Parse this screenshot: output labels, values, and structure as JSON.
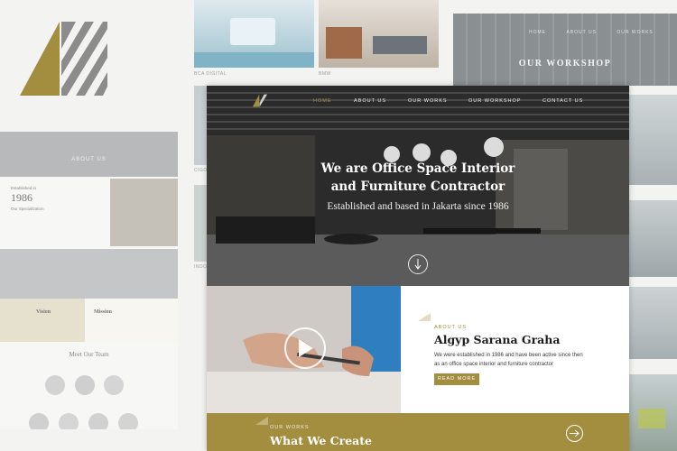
{
  "brand": {
    "gold": "#a38e40",
    "dark": "#2a2a2a"
  },
  "logo": {
    "icon": "brand-logo-triangle-stripes"
  },
  "background": {
    "thumbs": [
      {
        "caption": "BCA DIGITAL"
      },
      {
        "caption": "BMW"
      },
      {
        "caption": "CIGO"
      },
      {
        "caption": "INDO"
      }
    ],
    "workshop_page": {
      "nav": [
        "HOME",
        "ABOUT US",
        "OUR WORKS"
      ],
      "title": "OUR WORKSHOP"
    },
    "about_page": {
      "hero_title": "ABOUT US",
      "established_label": "Established in",
      "established_year": "1986",
      "specialization_label": "Our Specialization",
      "vision": "Vision",
      "mission": "Mission",
      "team_title": "Meet Our Team"
    }
  },
  "hero": {
    "nav": [
      {
        "label": "HOME",
        "active": true
      },
      {
        "label": "ABOUT US"
      },
      {
        "label": "OUR WORKS"
      },
      {
        "label": "OUR WORKSHOP"
      },
      {
        "label": "CONTACT US"
      }
    ],
    "title_line1": "We are Office Space Interior",
    "title_line2": "and Furniture Contractor",
    "subtitle": "Established and based in Jakarta since 1986",
    "scroll_icon": "arrow-down-circle-icon"
  },
  "about": {
    "eyebrow": "ABOUT US",
    "title": "Algyp Sarana Graha",
    "body": "We were established in 1986 and have been active since then as an office space interior and furniture contractor",
    "button": "READ MORE",
    "video_icon": "play-icon"
  },
  "works": {
    "eyebrow": "OUR WORKS",
    "title": "What We Create",
    "arrow_icon": "arrow-right-circle-icon"
  }
}
